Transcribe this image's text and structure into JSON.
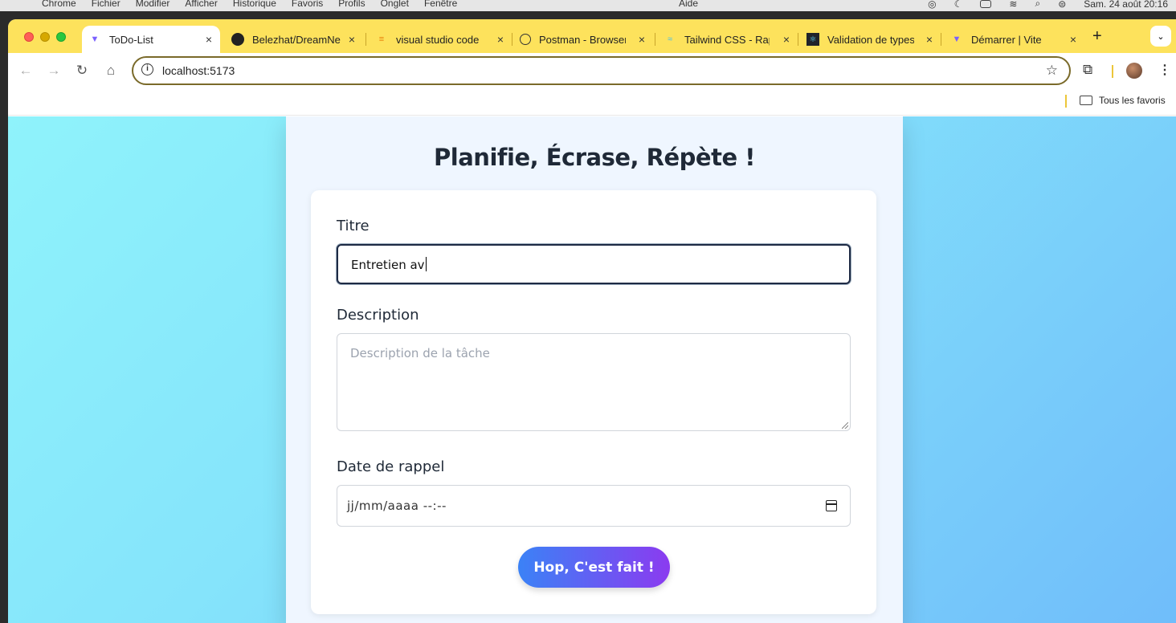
{
  "os_menubar": {
    "items": [
      "Chrome",
      "Fichier",
      "Modifier",
      "Afficher",
      "Historique",
      "Favoris",
      "Profils",
      "Onglet",
      "Fenêtre"
    ],
    "help": "Aide",
    "datetime": "Sam. 24 août  20:16"
  },
  "tabs": [
    {
      "title": "ToDo-List",
      "icon": "vite-icon",
      "active": true
    },
    {
      "title": "Belezhat/DreamNe",
      "icon": "github-icon"
    },
    {
      "title": "visual studio code",
      "icon": "stack-icon"
    },
    {
      "title": "Postman - Browser",
      "icon": "globe-icon"
    },
    {
      "title": "Tailwind CSS - Rap",
      "icon": "tailwind-icon"
    },
    {
      "title": "Validation de types",
      "icon": "react-icon"
    },
    {
      "title": "Démarrer | Vite",
      "icon": "vite-icon"
    }
  ],
  "address_bar": {
    "url": "localhost:5173"
  },
  "bookmarks": {
    "all_bookmarks_label": "Tous les favoris"
  },
  "app": {
    "heading": "Planifie, Écrase, Répète !",
    "form": {
      "title_label": "Titre",
      "title_value": "Entretien av",
      "description_label": "Description",
      "description_placeholder": "Description de la tâche",
      "date_label": "Date de rappel",
      "date_placeholder": "jj/mm/aaaa  --:--",
      "submit_label": "Hop, C'est fait !"
    }
  },
  "colors": {
    "tabstrip": "#fde25c",
    "page_gradient_start": "#8ff3fb",
    "page_gradient_end": "#70bdfa",
    "button_gradient_start": "#3b82f6",
    "button_gradient_end": "#8b3bf0"
  }
}
